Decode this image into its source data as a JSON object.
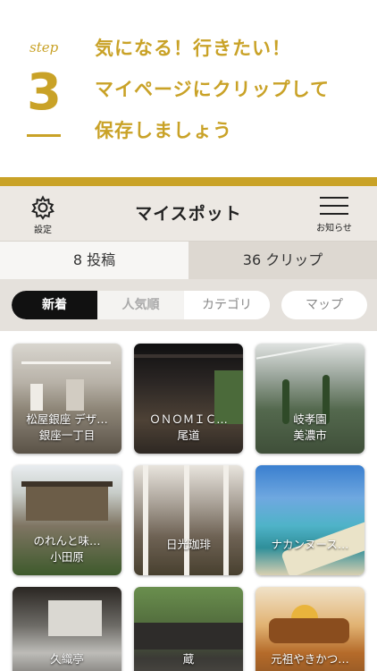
{
  "promo": {
    "step_word": "step",
    "step_number": "3",
    "lines": [
      "気になる！行きたい！",
      "マイページにクリップして",
      "保存しましょう"
    ]
  },
  "nav": {
    "settings_label": "設定",
    "title": "マイスポット",
    "news_label": "お知らせ"
  },
  "segments": {
    "posts": "8 投稿",
    "clips": "36 クリップ"
  },
  "filters": {
    "tabs": [
      "新着",
      "人気順",
      "カテゴリ"
    ],
    "active": "新着",
    "map": "マップ"
  },
  "spots": [
    {
      "line1": "松屋銀座 デザ…",
      "line2": "銀座一丁目"
    },
    {
      "line1": "ＯＮＯＭＩＣ…",
      "line2": "尾道"
    },
    {
      "line1": "岐孝園",
      "line2": "美濃市"
    },
    {
      "line1": "のれんと味…",
      "line2": "小田原"
    },
    {
      "line1": "日光珈琲",
      "line2": ""
    },
    {
      "line1": "ナカンヌース…",
      "line2": ""
    },
    {
      "line1": "久織亭",
      "line2": ""
    },
    {
      "line1": "蔵",
      "line2": ""
    },
    {
      "line1": "元祖やきかつ…",
      "line2": ""
    }
  ],
  "colors": {
    "accent_gold": "#c9a227",
    "app_bg": "#ece8e3",
    "active_pill": "#111111"
  }
}
